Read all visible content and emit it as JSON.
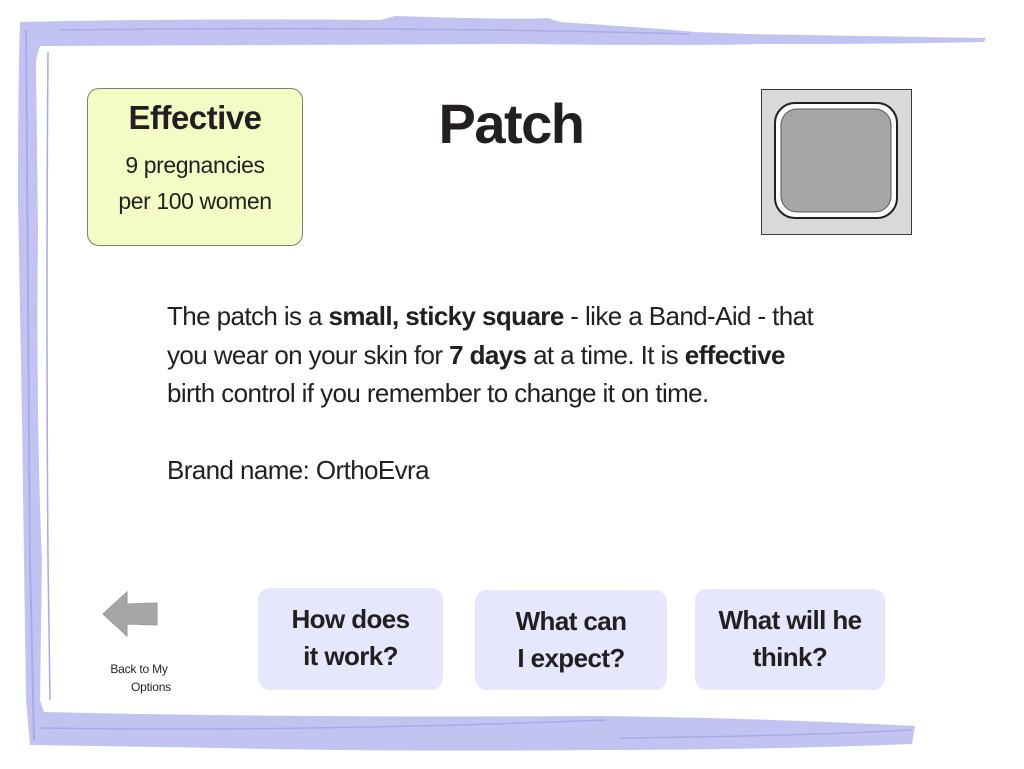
{
  "effectiveness": {
    "title": "Effective",
    "line1": "9 pregnancies",
    "line2": "per 100 women",
    "background_color": "#f4fbc4"
  },
  "title": "Patch",
  "patch_image": {
    "icon": "patch-square-icon",
    "fill_color": "#a6a6a6",
    "border_color": "#d9d9d9"
  },
  "description": {
    "line1": [
      {
        "text": "The patch is a ",
        "bold": false
      },
      {
        "text": "small, sticky square",
        "bold": true
      },
      {
        "text": " - like a Band-Aid - that",
        "bold": false
      }
    ],
    "line2": [
      {
        "text": "you wear on your skin for ",
        "bold": false
      },
      {
        "text": "7 days",
        "bold": true
      },
      {
        "text": " at a time. It is ",
        "bold": false
      },
      {
        "text": "effective",
        "bold": true
      }
    ],
    "line3": [
      {
        "text": "birth control if you remember to change it on time.",
        "bold": false
      }
    ]
  },
  "brand": "Brand name: OrthoEvra",
  "back_button": {
    "icon": "back-arrow-icon",
    "line1": "Back to My",
    "line2": "Options"
  },
  "buttons": [
    {
      "line1": "How does",
      "line2": "it work?"
    },
    {
      "line1": "What can",
      "line2": "I expect?"
    },
    {
      "line1": "What will he",
      "line2": "think?"
    }
  ],
  "colors": {
    "frame": "#c3c3f2",
    "button_bg": "#e6e6fc",
    "arrow": "#a6a6a6",
    "text": "#231f20"
  }
}
